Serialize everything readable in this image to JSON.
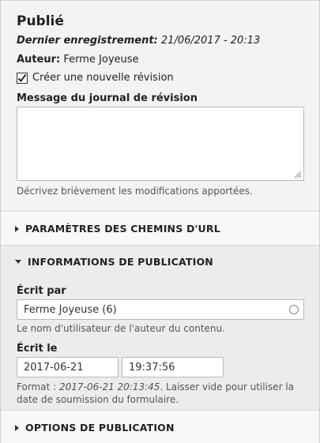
{
  "meta": {
    "status": "Publié",
    "last_saved_label": "Dernier enregistrement:",
    "last_saved_value": "21/06/2017 - 20:13",
    "author_label": "Auteur:",
    "author_value": "Ferme Joyeuse",
    "new_revision_label": "Créer une nouvelle révision",
    "new_revision_checked": true,
    "revision_log_label": "Message du journal de révision",
    "revision_log_value": "",
    "revision_log_description": "Décrivez brièvement les modifications apportées."
  },
  "url_alias": {
    "summary": "PARAMÈTRES DES CHEMINS D'URL",
    "expanded": false
  },
  "authoring": {
    "summary": "INFORMATIONS DE PUBLICATION",
    "expanded": true,
    "author_label": "Écrit par",
    "author_value": "Ferme Joyeuse (6)",
    "author_description": "Le nom d'utilisateur de l'auteur du contenu.",
    "date_label": "Écrit le",
    "date_value": "2017-06-21",
    "time_value": "19:37:56",
    "format_prefix": "Format : ",
    "format_example": "2017-06-21 20:13:45",
    "format_suffix_line1": ". Laisser vide pour utiliser la",
    "format_suffix_line2": "date de soumission du formulaire."
  },
  "options": {
    "summary": "OPTIONS DE PUBLICATION",
    "expanded": false
  }
}
